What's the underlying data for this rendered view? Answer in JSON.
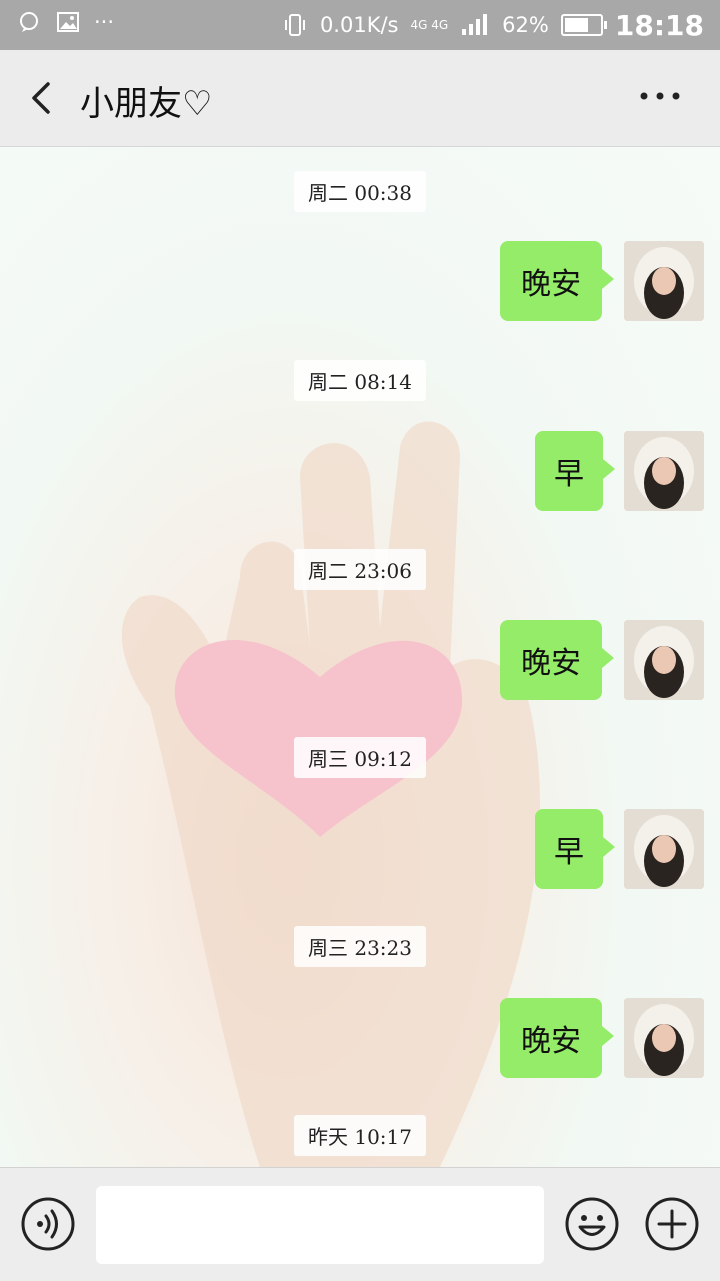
{
  "status_bar": {
    "speed": "0.01K/s",
    "network": "4G 4G",
    "battery": "62%",
    "time": "18:18"
  },
  "header": {
    "title": "小朋友♡"
  },
  "messages": [
    {
      "time": "周二 00:38",
      "text": "晚安"
    },
    {
      "time": "周二 08:14",
      "text": "早"
    },
    {
      "time": "周二 23:06",
      "text": "晚安"
    },
    {
      "time": "周三 09:12",
      "text": "早"
    },
    {
      "time": "周三 23:23",
      "text": "晚安"
    },
    {
      "time": "昨天 10:17"
    }
  ],
  "input": {
    "value": "",
    "placeholder": ""
  },
  "colors": {
    "bubble": "#95ec69",
    "header_bg": "#ececec",
    "status_bg": "#a8a8a8",
    "heart": "#f6c3cc"
  }
}
